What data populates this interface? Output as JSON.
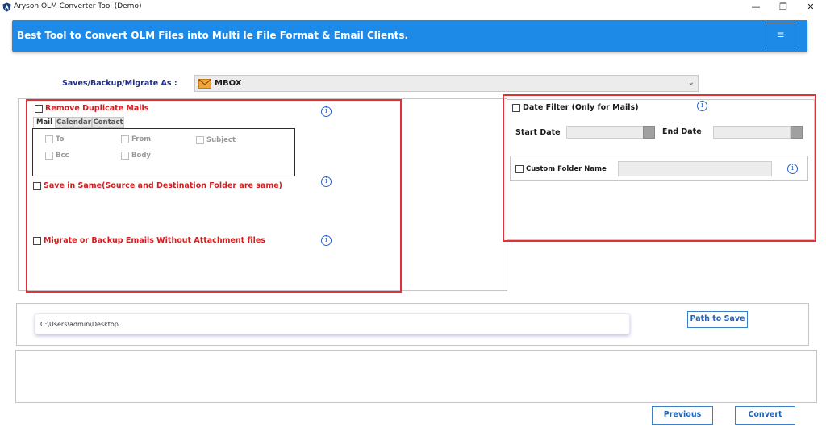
{
  "window": {
    "title": "Aryson OLM Converter Tool (Demo)",
    "minimize": "—",
    "restore": "❐",
    "close": "✕"
  },
  "banner": {
    "text": "Best Tool to Convert OLM Files into Multi le File Format & Email Clients.",
    "menu_icon": "≡"
  },
  "format": {
    "label": "Saves/Backup/Migrate As :",
    "selected": "MBOX",
    "icon": "envelope-icon"
  },
  "options": {
    "remove_duplicates": {
      "label": "Remove Duplicate Mails",
      "checked": false
    },
    "tabs": [
      {
        "label": "Mail",
        "active": true
      },
      {
        "label": "Calendar",
        "active": false
      },
      {
        "label": "Contact",
        "active": false
      }
    ],
    "mail_fields": [
      {
        "label": "To"
      },
      {
        "label": "From"
      },
      {
        "label": "Subject"
      },
      {
        "label": "Bcc"
      },
      {
        "label": "Body"
      }
    ],
    "save_in_same": {
      "label": "Save in Same(Source and Destination Folder are same)",
      "checked": false
    },
    "without_attachment": {
      "label": "Migrate or Backup Emails Without Attachment files",
      "checked": false
    },
    "info_glyph": "i"
  },
  "date_filter": {
    "label": "Date Filter  (Only for Mails)",
    "checked": false,
    "start_label": "Start Date",
    "end_label": "End Date",
    "start_value": "",
    "end_value": ""
  },
  "custom_folder": {
    "label": "Custom Folder Name",
    "checked": false,
    "value": ""
  },
  "path": {
    "value": "C:\\Users\\admin\\Desktop",
    "button": "Path to Save"
  },
  "footer": {
    "previous": "Previous",
    "convert": "Convert"
  },
  "colors": {
    "banner": "#1e8ae8",
    "highlight_border": "#e0303a",
    "option_label": "#d01f22",
    "format_label": "#1f2e8a",
    "button_text": "#1f64b8"
  }
}
